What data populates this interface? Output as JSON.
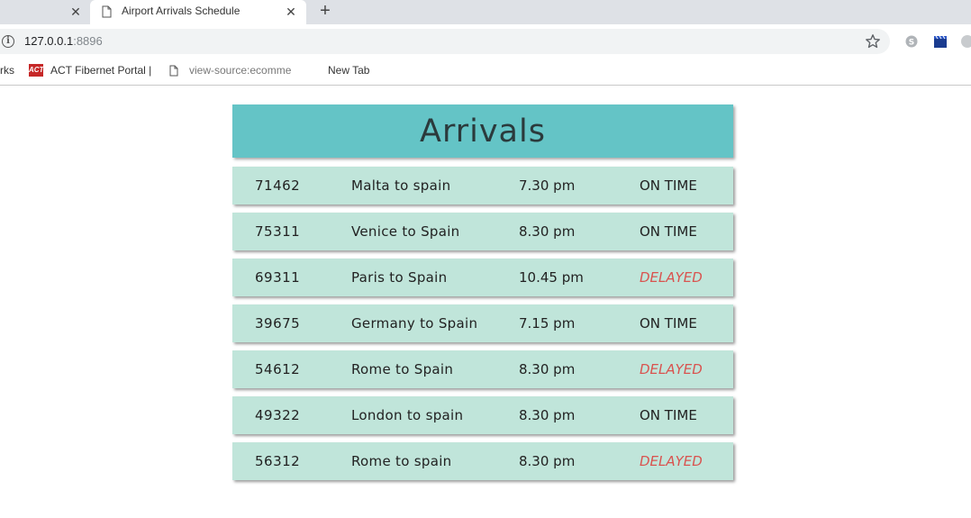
{
  "browser": {
    "tabs": [
      {
        "title": ""
      },
      {
        "title": "Airport Arrivals Schedule",
        "active": true
      }
    ],
    "close_glyph": "✕",
    "new_tab_glyph": "+",
    "url_host": "127.0.0.1",
    "url_port": ":8896",
    "bookmarks": [
      {
        "label": "rks",
        "icon": "none"
      },
      {
        "label": "ACT Fibernet Portal |",
        "icon": "act-logo-icon"
      },
      {
        "label": "view-source:ecomme",
        "icon": "page-icon"
      },
      {
        "label": "New Tab",
        "icon": "none"
      }
    ],
    "act_logo_text": "ACT"
  },
  "board": {
    "title": "Arrivals",
    "colors": {
      "header_bg": "#64c4c6",
      "row_bg": "#c0e5da",
      "delayed": "#d9534f"
    },
    "flights": [
      {
        "number": "71462",
        "route": "Malta to spain",
        "time": "7.30 pm",
        "status": "ON TIME"
      },
      {
        "number": "75311",
        "route": "Venice to Spain",
        "time": "8.30 pm",
        "status": "ON TIME"
      },
      {
        "number": "69311",
        "route": "Paris to Spain",
        "time": "10.45 pm",
        "status": "DELAYED"
      },
      {
        "number": "39675",
        "route": "Germany to Spain",
        "time": "7.15 pm",
        "status": "ON TIME"
      },
      {
        "number": "54612",
        "route": "Rome to Spain",
        "time": "8.30 pm",
        "status": "DELAYED"
      },
      {
        "number": "49322",
        "route": "London to spain",
        "time": "8.30 pm",
        "status": "ON TIME"
      },
      {
        "number": "56312",
        "route": "Rome to spain",
        "time": "8.30 pm",
        "status": "DELAYED"
      }
    ]
  }
}
